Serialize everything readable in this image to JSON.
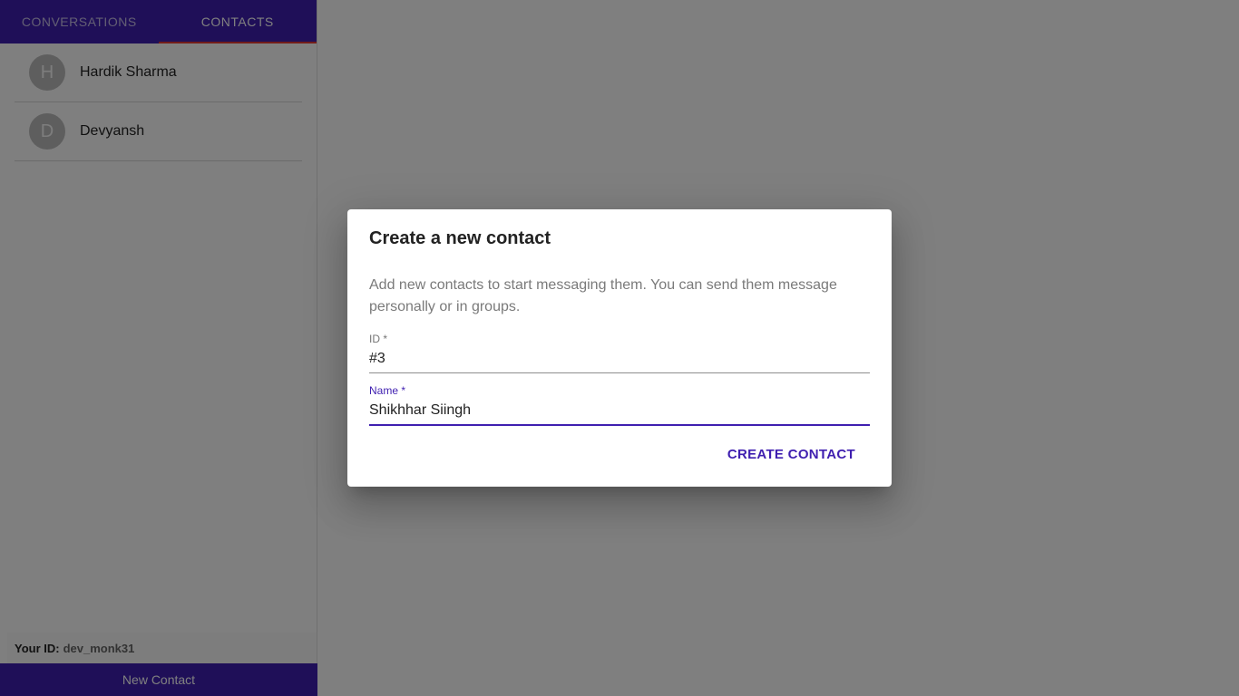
{
  "tabs": [
    {
      "label": "Conversations"
    },
    {
      "label": "Contacts"
    }
  ],
  "contacts": [
    {
      "initial": "H",
      "name": "Hardik Sharma"
    },
    {
      "initial": "D",
      "name": "Devyansh"
    }
  ],
  "footer": {
    "your_id_label": "Your ID:",
    "your_id_value": "dev_monk31",
    "new_contact_label": "New Contact"
  },
  "dialog": {
    "title": "Create a new contact",
    "description": "Add new contacts to start messaging them. You can send them message personally or in groups.",
    "id_label": "ID *",
    "id_value": "#3",
    "name_label": "Name *",
    "name_value": "Shikhhar Siingh",
    "create_label": "Create Contact"
  },
  "colors": {
    "primary": "#3f1fb0",
    "tab_indicator": "#e53935",
    "avatar_bg": "#bdbdbd"
  }
}
